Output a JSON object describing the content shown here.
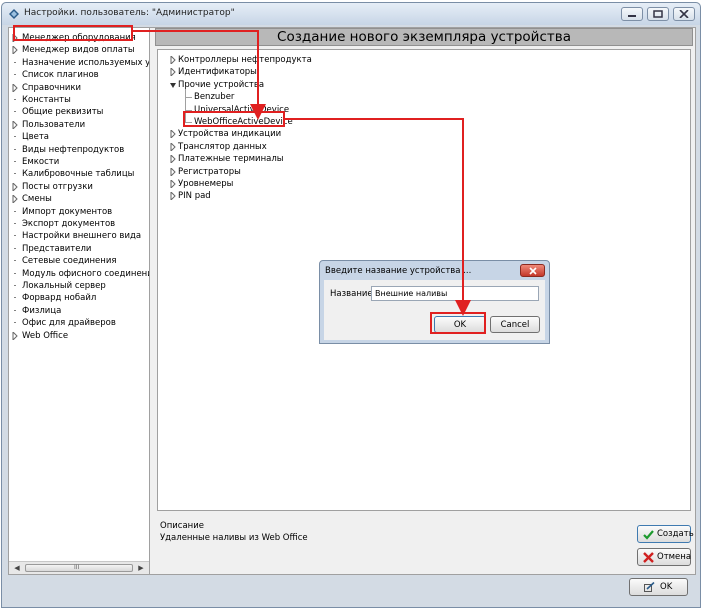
{
  "window": {
    "title": "Настройки. пользователь: \"Администратор\""
  },
  "sidebar": {
    "items": [
      {
        "label": "Менеджер оборудования",
        "expandable": true
      },
      {
        "label": "Менеджер видов оплаты",
        "expandable": true
      },
      {
        "label": "Назначение используемых устр",
        "expandable": false
      },
      {
        "label": "Список плагинов",
        "expandable": false
      },
      {
        "label": "Справочники",
        "expandable": true
      },
      {
        "label": "Константы",
        "expandable": false
      },
      {
        "label": "Общие реквизиты",
        "expandable": false
      },
      {
        "label": "Пользователи",
        "expandable": true
      },
      {
        "label": "Цвета",
        "expandable": false
      },
      {
        "label": "Виды нефтепродуктов",
        "expandable": false
      },
      {
        "label": "Емкости",
        "expandable": false
      },
      {
        "label": "Калибровочные таблицы",
        "expandable": false
      },
      {
        "label": "Посты отгрузки",
        "expandable": true
      },
      {
        "label": "Смены",
        "expandable": true
      },
      {
        "label": "Импорт документов",
        "expandable": false
      },
      {
        "label": "Экспорт документов",
        "expandable": false
      },
      {
        "label": "Настройки внешнего вида",
        "expandable": false
      },
      {
        "label": "Представители",
        "expandable": false
      },
      {
        "label": "Сетевые соединения",
        "expandable": false
      },
      {
        "label": "Модуль офисного соединения",
        "expandable": false
      },
      {
        "label": "Локальный сервер",
        "expandable": false
      },
      {
        "label": "Форвард нобайл",
        "expandable": false
      },
      {
        "label": "Физлица",
        "expandable": false
      },
      {
        "label": "Офис для драйверов",
        "expandable": false
      },
      {
        "label": "Web Office",
        "expandable": true
      }
    ],
    "scroll_grip": "III"
  },
  "header": {
    "title": "Создание нового экземпляра устройства"
  },
  "tree": {
    "items_top": [
      {
        "label": "Контроллеры нефтепродукта",
        "expanded": false
      },
      {
        "label": "Идентификаторы",
        "expanded": false
      },
      {
        "label": "Прочие устройства",
        "expanded": true
      }
    ],
    "children": [
      "Benzuber",
      "UniversalActiveDevice",
      "WebOfficeActiveDevice"
    ],
    "items_bottom": [
      {
        "label": "Устройства индикации",
        "expanded": false
      },
      {
        "label": "Транслятор данных",
        "expanded": false
      },
      {
        "label": "Платежные терминалы",
        "expanded": false
      },
      {
        "label": "Регистраторы",
        "expanded": false
      },
      {
        "label": "Уровнемеры",
        "expanded": false
      },
      {
        "label": "PIN pad",
        "expanded": false
      }
    ]
  },
  "description": {
    "label": "Описание",
    "text": "Удаленные наливы из Web Office"
  },
  "buttons": {
    "create": "Создать",
    "cancel": "Отмена",
    "ok": "OK"
  },
  "dialog": {
    "title": "Введите название устройства ...",
    "field_label": "Название",
    "field_value": "Внешние наливы",
    "ok": "OK",
    "cancel": "Cancel"
  },
  "colors": {
    "highlight": "#e02020",
    "titlebar": "#c7d5e6",
    "header_bg": "#b8b8b8"
  }
}
